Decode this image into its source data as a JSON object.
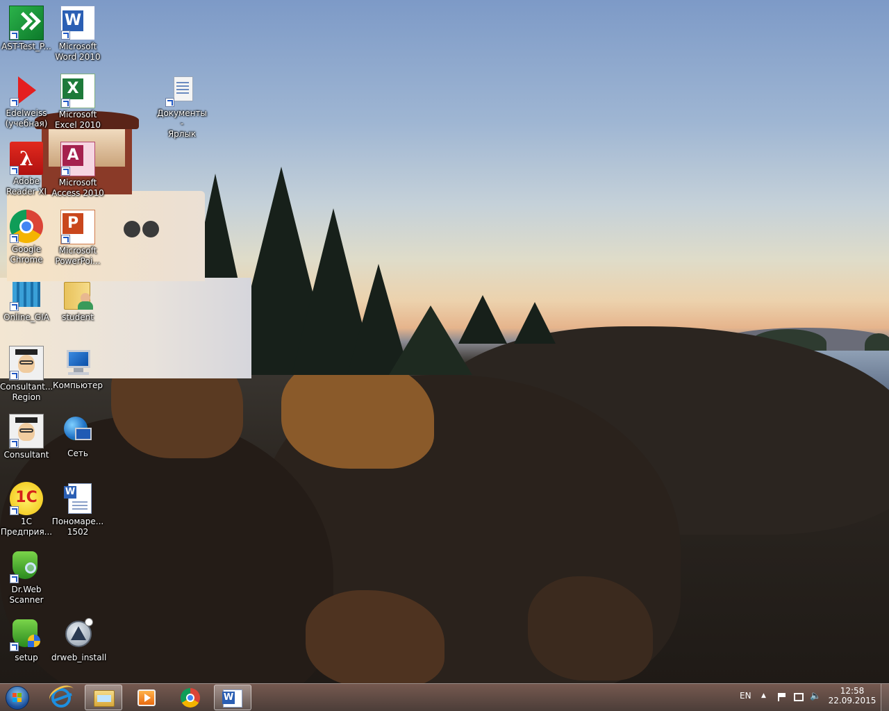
{
  "desktop_icons": [
    {
      "name": "AST-Test_P...",
      "icon": "ast-test-icon"
    },
    {
      "name": "Microsoft\nWord 2010",
      "icon": "word-icon"
    },
    {
      "name": "Edelweiss\n(учебная)",
      "icon": "edelweiss-icon"
    },
    {
      "name": "Microsoft\nExcel 2010",
      "icon": "excel-icon"
    },
    {
      "name": "Документы -\nЯрлык",
      "icon": "documents-icon"
    },
    {
      "name": "Adobe\nReader XI",
      "icon": "adobe-reader-icon"
    },
    {
      "name": "Microsoft\nAccess 2010",
      "icon": "access-icon"
    },
    {
      "name": "Google\nChrome",
      "icon": "chrome-icon"
    },
    {
      "name": "Microsoft\nPowerPoi...",
      "icon": "powerpoint-icon"
    },
    {
      "name": "Online_GIA",
      "icon": "online-gia-icon"
    },
    {
      "name": "student",
      "icon": "user-folder-icon"
    },
    {
      "name": "Consultant...\nRegion",
      "icon": "consultant-icon"
    },
    {
      "name": "Компьютер",
      "icon": "computer-icon"
    },
    {
      "name": "Consultant",
      "icon": "consultant-icon"
    },
    {
      "name": "Сеть",
      "icon": "network-icon"
    },
    {
      "name": "1C\nПредприя...",
      "icon": "1c-icon"
    },
    {
      "name": "Пономаре...\n1502",
      "icon": "word-doc-icon"
    },
    {
      "name": "Dr.Web\nScanner",
      "icon": "drweb-scanner-icon"
    },
    {
      "name": "setup",
      "icon": "setup-icon"
    },
    {
      "name": "drweb_install",
      "icon": "drweb-install-icon"
    }
  ],
  "taskbar": {
    "start_icon": "windows-start-icon",
    "pinned": [
      {
        "icon": "internet-explorer-icon"
      },
      {
        "icon": "file-explorer-icon"
      },
      {
        "icon": "media-player-icon"
      },
      {
        "icon": "chrome-icon"
      },
      {
        "icon": "word-icon"
      }
    ],
    "language": "EN",
    "time": "12:58",
    "date": "22.09.2015"
  }
}
